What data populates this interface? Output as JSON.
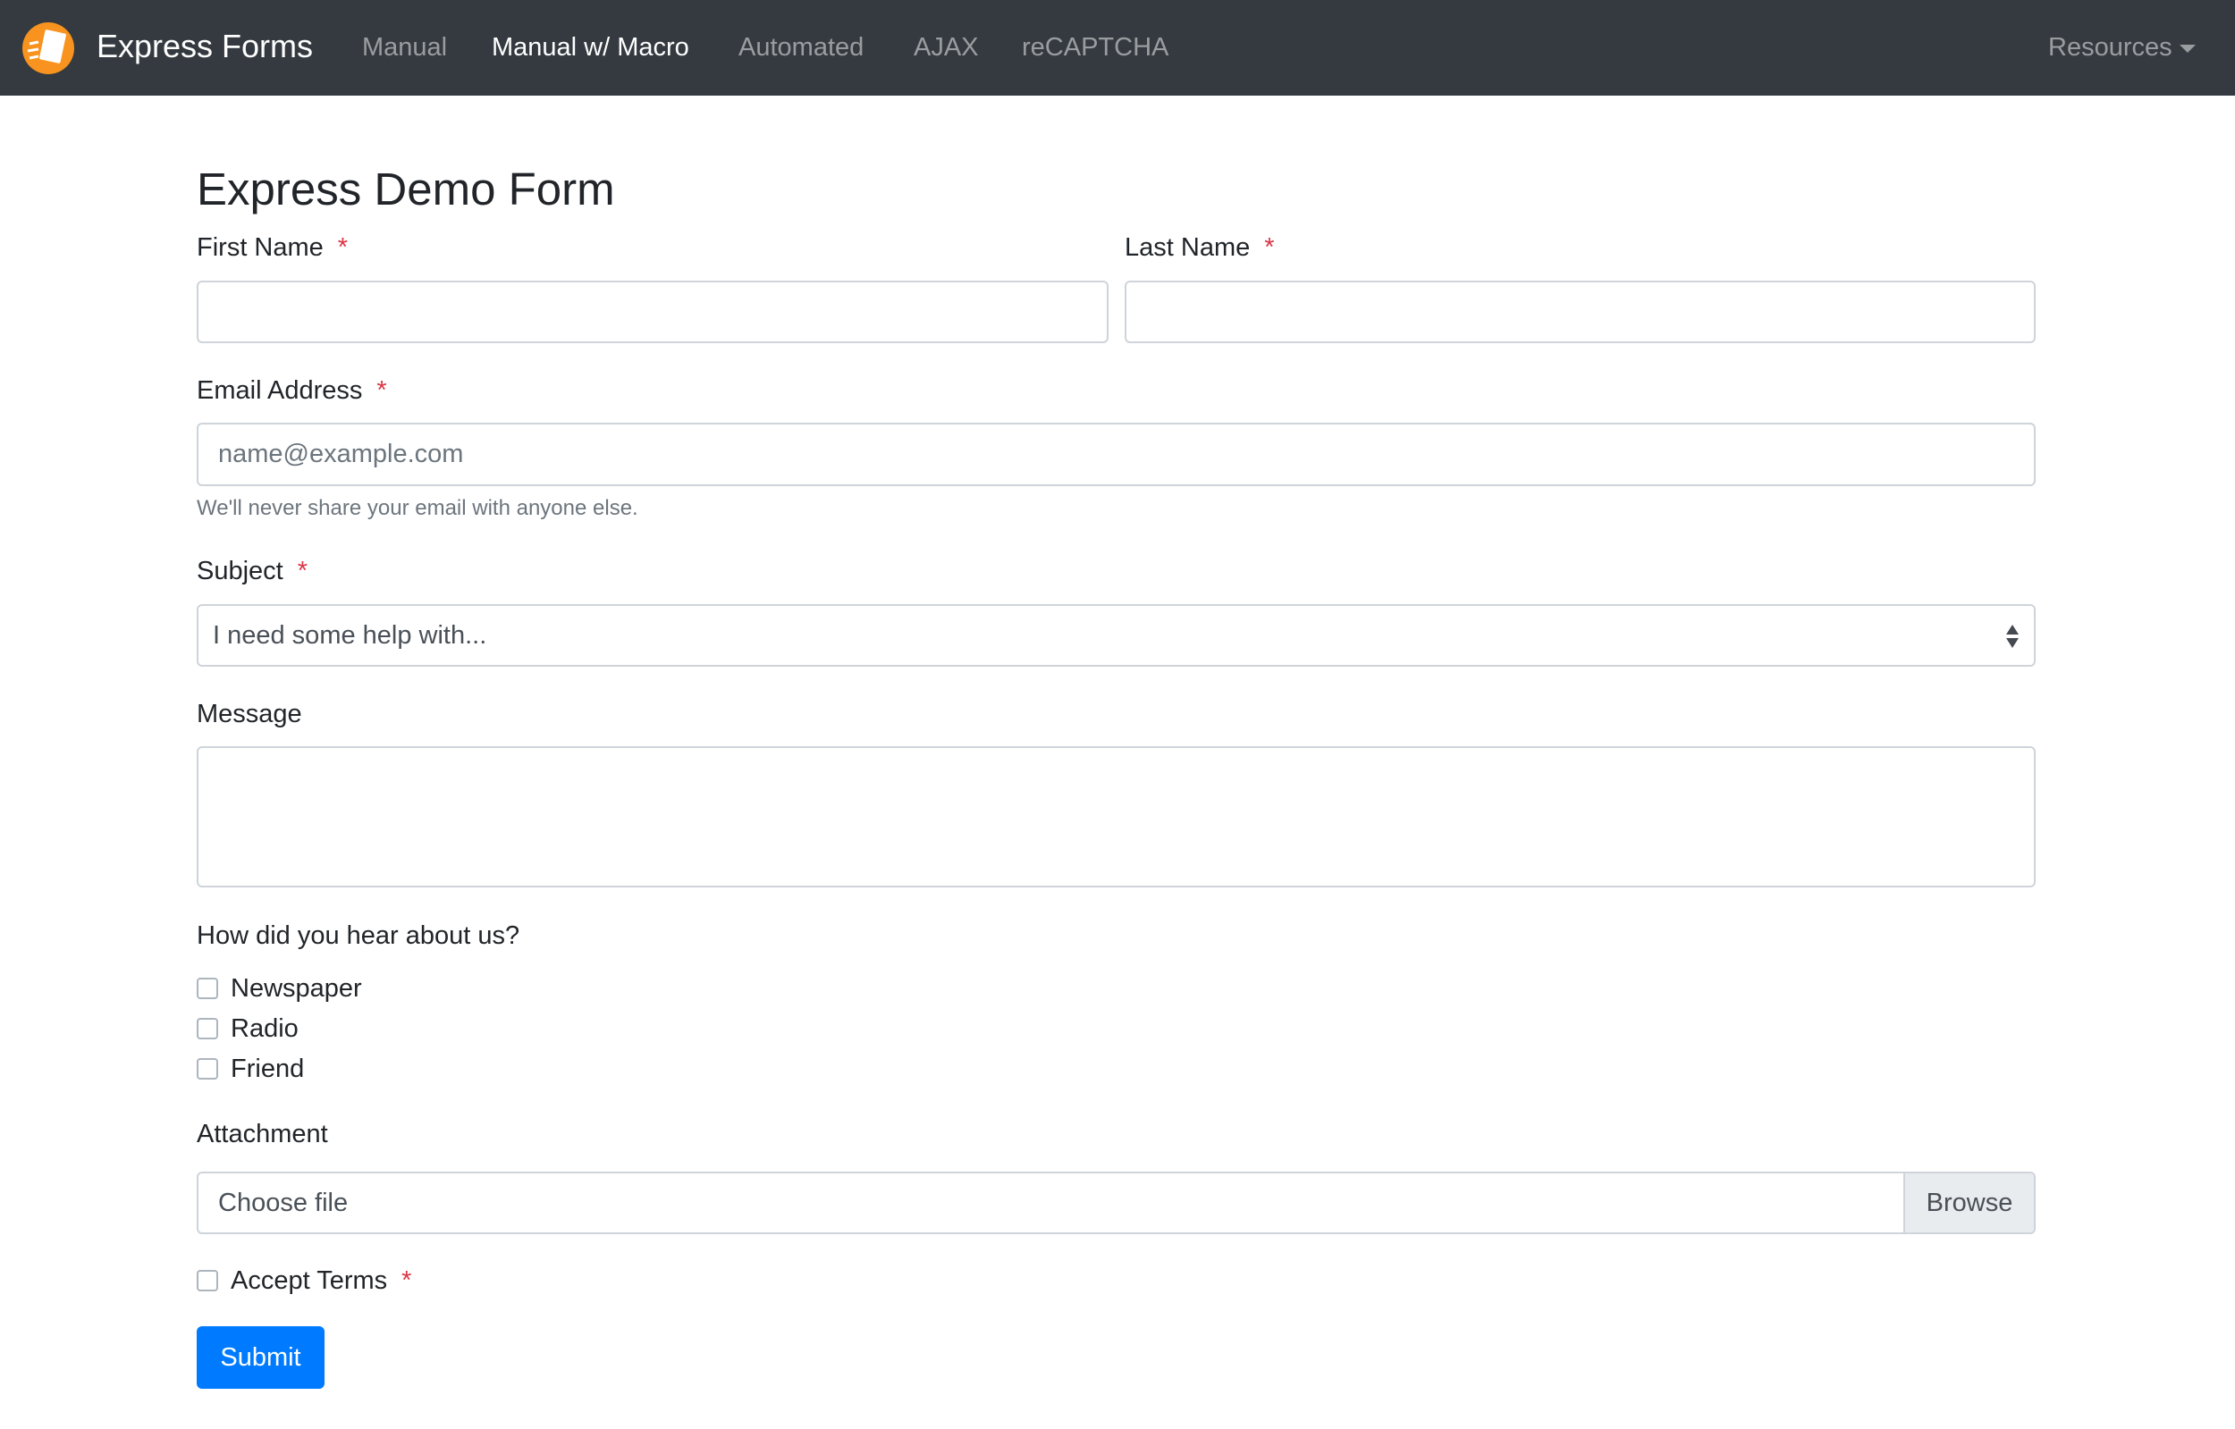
{
  "navbar": {
    "brand": "Express Forms",
    "links": [
      "Manual",
      "Manual w/ Macro",
      "Automated",
      "AJAX",
      "reCAPTCHA"
    ],
    "active": "Manual w/ Macro",
    "resources": "Resources",
    "bg": "#343a40",
    "logo_color": "#f7931e"
  },
  "form": {
    "title": "Express Demo Form",
    "first_name": "First Name",
    "last_name": "Last Name",
    "required_mark": "*",
    "email": "Email Address",
    "email_placeholder": "name@example.com",
    "email_help": "We'll never share your email with anyone else.",
    "subject": "Subject",
    "subject_value": "I need some help with...",
    "message": "Message",
    "hear": "How did you hear about us?",
    "options": [
      "Newspaper",
      "Radio",
      "Friend"
    ],
    "attachment": "Attachment",
    "choose_file": "Choose file",
    "browse": "Browse",
    "accept": "Accept Terms",
    "submit": "Submit",
    "submit_color": "#007bff"
  }
}
